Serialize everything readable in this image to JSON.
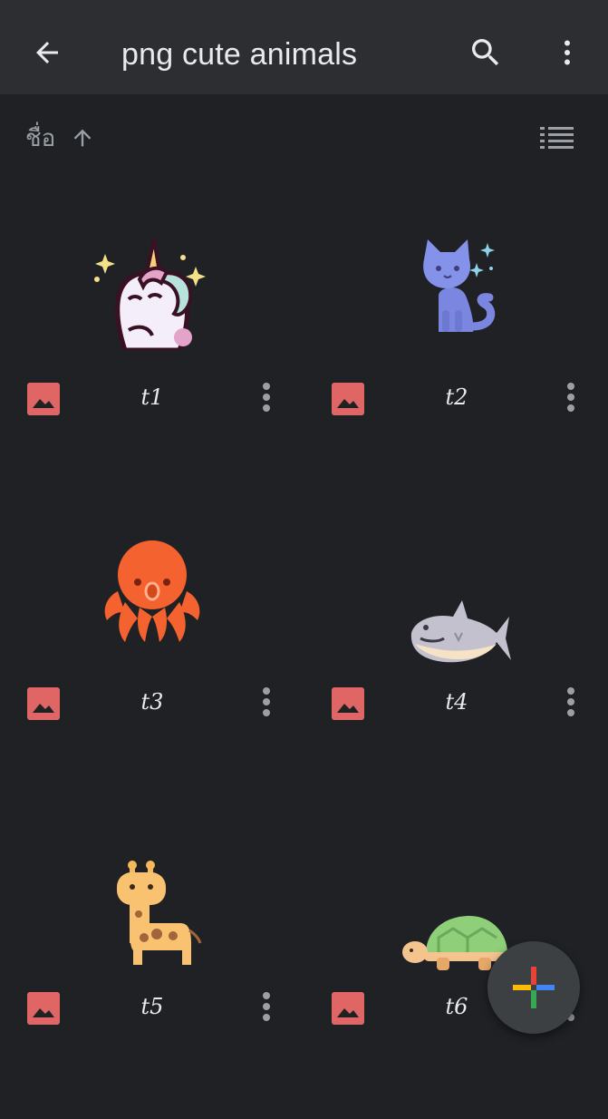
{
  "header": {
    "title": "png cute animals",
    "back_icon": "arrow-back-icon",
    "search_icon": "search-icon",
    "more_icon": "more-vert-icon"
  },
  "sort": {
    "label": "ชื่อ",
    "direction_icon": "arrow-up-icon",
    "view_icon": "list-view-icon"
  },
  "files": [
    {
      "name": "t1",
      "thumbnail": "unicorn"
    },
    {
      "name": "t2",
      "thumbnail": "cat"
    },
    {
      "name": "t3",
      "thumbnail": "octopus"
    },
    {
      "name": "t4",
      "thumbnail": "shark"
    },
    {
      "name": "t5",
      "thumbnail": "giraffe"
    },
    {
      "name": "t6",
      "thumbnail": "turtle"
    }
  ],
  "colors": {
    "background": "#202124",
    "appbar": "#2d2e31",
    "image_icon": "#e06666",
    "text": "#e8eaed",
    "muted": "#9aa0a6",
    "fab": "#3c4043"
  },
  "fab": {
    "icon": "plus-multicolor-icon"
  }
}
